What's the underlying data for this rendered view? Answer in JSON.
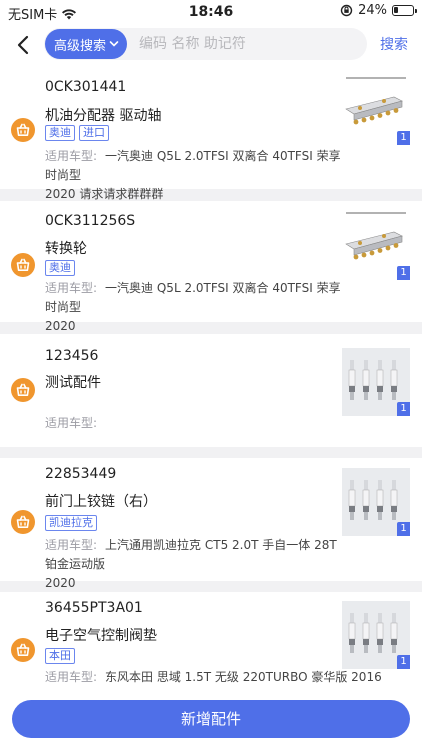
{
  "status_bar": {
    "carrier": "无SIM卡",
    "time": "18:46",
    "battery_percent": "24%",
    "battery_level": 0.24
  },
  "nav": {
    "advanced_search_label": "高级搜索",
    "search_placeholder": "编码 名称 助记符",
    "search_button": "搜索"
  },
  "vehicle_label": "适用车型:",
  "parts": [
    {
      "code": "0CK301441",
      "name": "机油分配器 驱动轴",
      "tags": [
        "奥迪",
        "进口"
      ],
      "vehicle_line1": "一汽奥迪 Q5L 2.0TFSI 双离合 40TFSI 荣享时尚型",
      "vehicle_line2": "2020 请求请求群群群",
      "image_count": "1",
      "image_icon": "distributor-manifold"
    },
    {
      "code": "0CK311256S",
      "name": "转换轮",
      "tags": [
        "奥迪"
      ],
      "vehicle_line1": "一汽奥迪 Q5L 2.0TFSI 双离合 40TFSI 荣享时尚型",
      "vehicle_line2": "2020",
      "image_count": "1",
      "image_icon": "distributor-manifold"
    },
    {
      "code": "123456",
      "name": "测试配件",
      "tags": [],
      "vehicle_line1": "",
      "vehicle_line2": "",
      "image_count": "1",
      "image_icon": "spark-plugs"
    },
    {
      "code": "22853449",
      "name": "前门上铰链（右）",
      "tags": [
        "凯迪拉克"
      ],
      "vehicle_line1": "上汽通用凯迪拉克 CT5 2.0T 手自一体 28T 铂金运动版",
      "vehicle_line2": "2020",
      "image_count": "1",
      "image_icon": "spark-plugs"
    },
    {
      "code": "36455PT3A01",
      "name": "电子空气控制阀垫",
      "tags": [
        "本田"
      ],
      "vehicle_line1": "东风本田 思域 1.5T 无级 220TURBO 豪华版 2016",
      "vehicle_line2": "",
      "image_count": "1",
      "image_icon": "spark-plugs"
    }
  ],
  "add_part_button": "新增配件",
  "colors": {
    "accent": "#4f6fe8",
    "cart_icon": "#f0962e",
    "background": "#f1f1f3"
  }
}
